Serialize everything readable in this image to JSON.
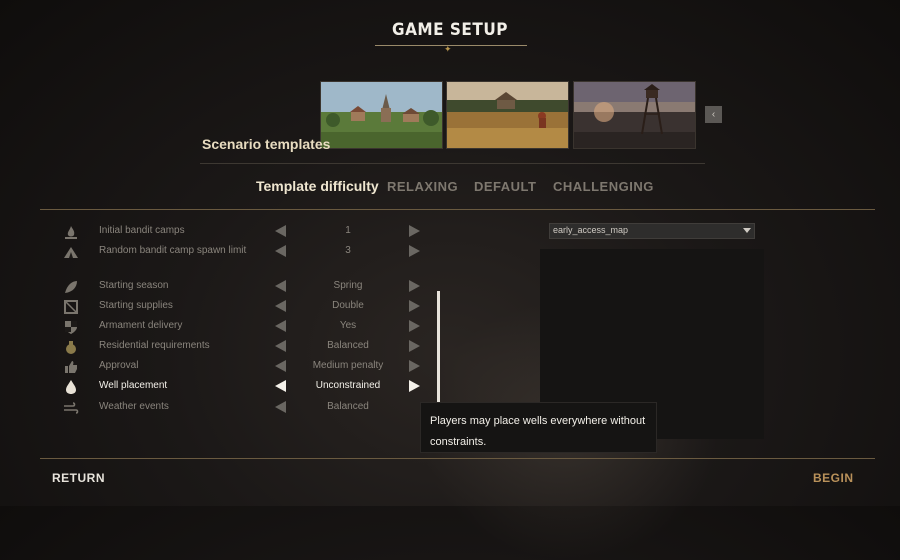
{
  "title": "GAME SETUP",
  "scenario": {
    "label": "Scenario templates",
    "thumbnails": [
      "village-thumbnail",
      "wheat-field-thumbnail",
      "watchtower-thumbnail"
    ]
  },
  "difficulty": {
    "label": "Template difficulty",
    "options": [
      "RELAXING",
      "DEFAULT",
      "CHALLENGING"
    ]
  },
  "settings": [
    {
      "label": "Initial bandit camps",
      "value": "1",
      "icon": "campfire-icon"
    },
    {
      "label": "Random bandit camp spawn limit",
      "value": "3",
      "icon": "tent-icon"
    },
    {
      "label": "Starting season",
      "value": "Spring",
      "icon": "leaf-icon"
    },
    {
      "label": "Starting supplies",
      "value": "Double",
      "icon": "crate-icon"
    },
    {
      "label": "Armament delivery",
      "value": "Yes",
      "icon": "shield-icon"
    },
    {
      "label": "Residential requirements",
      "value": "Balanced",
      "icon": "pouch-icon"
    },
    {
      "label": "Approval",
      "value": "Medium penalty",
      "icon": "thumbs-up-icon"
    },
    {
      "label": "Well placement",
      "value": "Unconstrained",
      "icon": "water-drop-icon"
    },
    {
      "label": "Weather events",
      "value": "Balanced",
      "icon": "wind-icon"
    }
  ],
  "map": {
    "selected": "early_access_map"
  },
  "tooltip": "Players may place wells everywhere without constraints.",
  "footer": {
    "return": "RETURN",
    "begin": "BEGIN"
  },
  "colors": {
    "accent": "#b9915a",
    "highlight": "#f4f1ea",
    "muted": "#8a857d"
  }
}
